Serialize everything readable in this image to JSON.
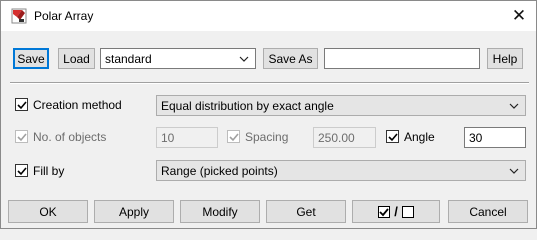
{
  "window": {
    "title": "Polar Array",
    "close_glyph": "✕"
  },
  "toolbar": {
    "save_label": "Save",
    "load_label": "Load",
    "preset_value": "standard",
    "save_as_label": "Save As",
    "save_as_value": "",
    "help_label": "Help"
  },
  "creation_method": {
    "label": "Creation method",
    "checked": true,
    "value": "Equal distribution by exact angle"
  },
  "no_of_objects": {
    "label": "No. of objects",
    "checked": true,
    "enabled": false,
    "value": "10"
  },
  "spacing": {
    "label": "Spacing",
    "checked": true,
    "enabled": false,
    "value": "250.00"
  },
  "angle": {
    "label": "Angle",
    "checked": true,
    "value": "30"
  },
  "fill_by": {
    "label": "Fill by",
    "checked": true,
    "value": "Range (picked points)"
  },
  "buttons": {
    "ok": "OK",
    "apply": "Apply",
    "modify": "Modify",
    "get": "Get",
    "toggle_separator": "/",
    "cancel": "Cancel"
  },
  "colors": {
    "focus": "#0078d7",
    "icon_red": "#d62f2f"
  },
  "icons": [
    "app-icon",
    "close-icon",
    "chevron-down-icon",
    "check-icon"
  ]
}
